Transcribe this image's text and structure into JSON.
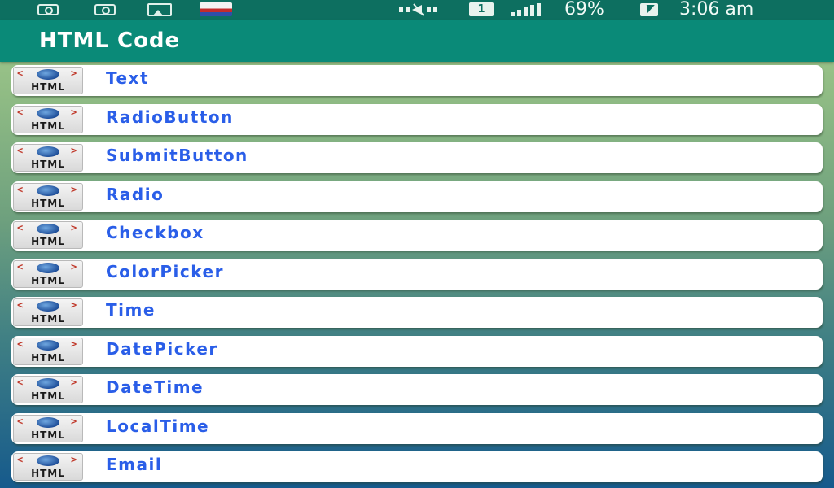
{
  "status_bar": {
    "battery": "69%",
    "time": "3:06 am",
    "sim": "1",
    "icons": [
      "camera-icon",
      "camera-icon",
      "gallery-icon",
      "app-icon",
      "mute-icon",
      "sim-icon",
      "signal-icon",
      "battery-charging-icon"
    ]
  },
  "action_bar": {
    "title": "HTML Code"
  },
  "list": {
    "icon_label": "HTML",
    "items": [
      {
        "label": "Text"
      },
      {
        "label": "RadioButton"
      },
      {
        "label": "SubmitButton"
      },
      {
        "label": "Radio"
      },
      {
        "label": "Checkbox"
      },
      {
        "label": "ColorPicker"
      },
      {
        "label": "Time"
      },
      {
        "label": "DatePicker"
      },
      {
        "label": "DateTime"
      },
      {
        "label": "LocalTime"
      },
      {
        "label": "Email"
      }
    ]
  },
  "colors": {
    "status_bar": "#0d6f60",
    "action_bar": "#0a8a78",
    "item_text": "#2a5ee8",
    "item_background": "#ffffff"
  }
}
